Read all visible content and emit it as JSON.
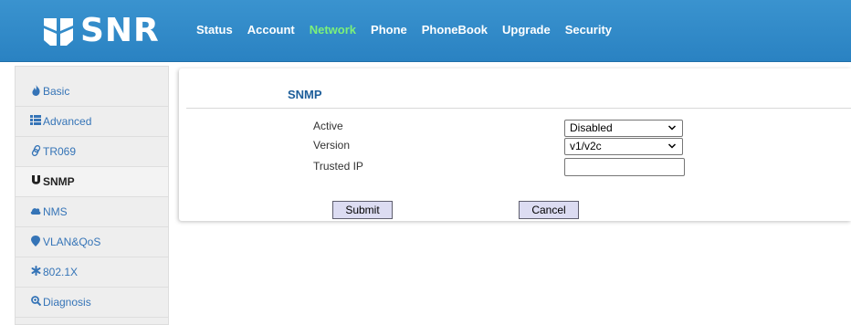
{
  "brand": {
    "name": "SNR"
  },
  "nav": {
    "items": [
      {
        "label": "Status"
      },
      {
        "label": "Account"
      },
      {
        "label": "Network"
      },
      {
        "label": "Phone"
      },
      {
        "label": "PhoneBook"
      },
      {
        "label": "Upgrade"
      },
      {
        "label": "Security"
      }
    ],
    "active": "Network",
    "active_color": "#7cf07a"
  },
  "sidebar": {
    "items": [
      {
        "label": "Basic",
        "icon": "flame-icon"
      },
      {
        "label": "Advanced",
        "icon": "list-icon"
      },
      {
        "label": "TR069",
        "icon": "link-icon"
      },
      {
        "label": "SNMP",
        "icon": "magnet-icon"
      },
      {
        "label": "NMS",
        "icon": "cloud-icon"
      },
      {
        "label": "VLAN&QoS",
        "icon": "pin-icon"
      },
      {
        "label": "802.1X",
        "icon": "asterisk-icon"
      },
      {
        "label": "Diagnosis",
        "icon": "zoom-icon"
      }
    ],
    "active": "SNMP"
  },
  "panel": {
    "title": "SNMP",
    "fields": {
      "active": {
        "label": "Active",
        "value": "Disabled"
      },
      "version": {
        "label": "Version",
        "value": "v1/v2c"
      },
      "trusted_ip": {
        "label": "Trusted IP",
        "value": ""
      }
    },
    "submit_label": "Submit",
    "cancel_label": "Cancel"
  },
  "colors": {
    "header": "#2f89c8",
    "link": "#3574b7",
    "title": "#1d5e9a",
    "button": "#dcdcf2"
  }
}
